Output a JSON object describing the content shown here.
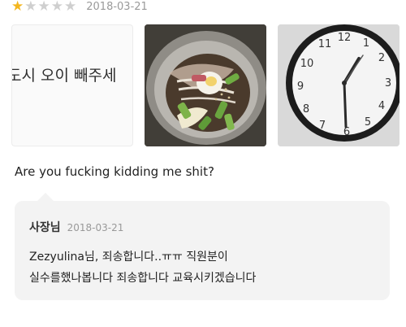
{
  "review": {
    "rating": 1,
    "max_rating": 5,
    "date": "2018-03-21",
    "text": "Are you fucking kidding me shit?"
  },
  "photos": [
    {
      "kind": "cropped-text",
      "text": "도시 오이 빼주세"
    },
    {
      "kind": "food-bowl",
      "description_icon": "cold-noodle-bowl"
    },
    {
      "kind": "wall-clock",
      "description_icon": "clock"
    }
  ],
  "reply": {
    "author_label": "사장님",
    "date": "2018-03-21",
    "line1": "Zezyulina님, 죄송합니다..ㅠㅠ  직원분이",
    "line2": "실수를했나봅니다 죄송합니다 교육시키겠습니다"
  },
  "colors": {
    "star_filled": "#f3b61f",
    "star_empty": "#cfcfcf",
    "reply_bg": "#f3f3f3"
  }
}
